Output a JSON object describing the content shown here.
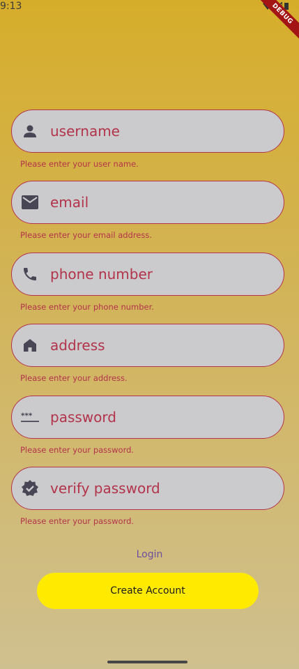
{
  "status_bar": {
    "time": "9:13",
    "debug_label": "DEBUG"
  },
  "fields": [
    {
      "placeholder": "username",
      "value": "",
      "error": "Please enter your user name.",
      "icon": "person-icon"
    },
    {
      "placeholder": "email",
      "value": "",
      "error": "Please enter your email address.",
      "icon": "email-icon"
    },
    {
      "placeholder": "phone number",
      "value": "",
      "error": "Please enter your phone number.",
      "icon": "phone-icon"
    },
    {
      "placeholder": "address",
      "value": "",
      "error": "Please enter your address.",
      "icon": "home-icon"
    },
    {
      "placeholder": "password",
      "value": "",
      "error": "Please enter your password.",
      "icon": "password-icon"
    },
    {
      "placeholder": "verify password",
      "value": "",
      "error": "Please enter your password.",
      "icon": "verified-icon"
    }
  ],
  "login_label": "Login",
  "create_account_label": "Create Account",
  "colors": {
    "accent_error": "#b3334b",
    "field_bg": "#cbcbcd",
    "button_bg": "#ffea00",
    "link": "#6c4ea0",
    "icon": "#484654"
  }
}
